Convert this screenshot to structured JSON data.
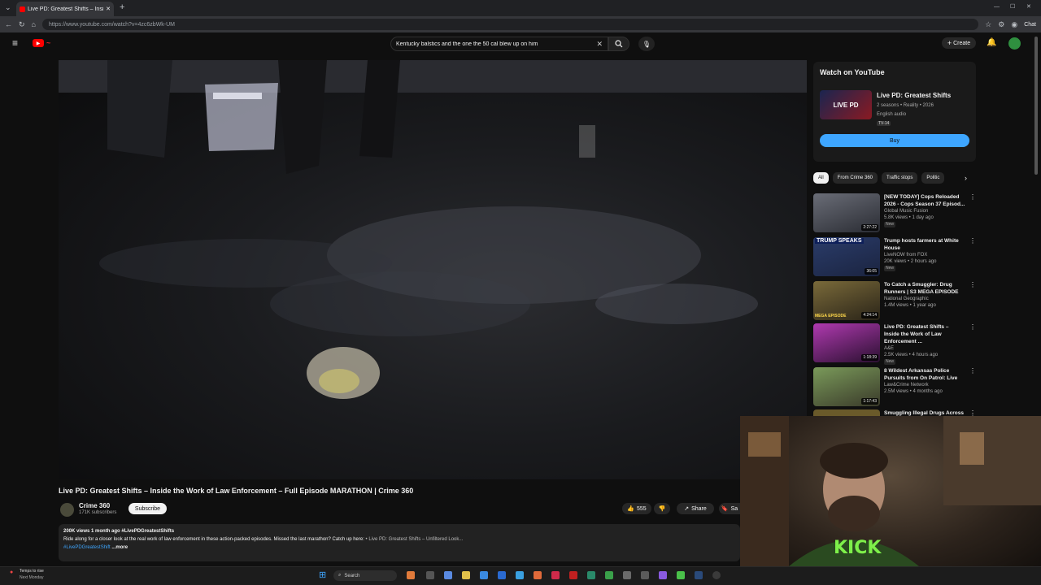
{
  "browser": {
    "tab_title": "Live PD: Greatest Shifts – Insi",
    "url": "https://www.youtube.com/watch?v=4zc6zbWk-UM",
    "chat_label": "Chat"
  },
  "header": {
    "search_value": "Kentucky balstics and the one the 50 cal blew up on him",
    "create_label": "Create"
  },
  "video": {
    "title": "Live PD: Greatest Shifts – Inside the Work of Law Enforcement – Full Episode MARATHON | Crime 360",
    "channel": "Crime 360",
    "subscribers": "171K subscribers",
    "subscribe_label": "Subscribe",
    "likes": "555",
    "share_label": "Share",
    "save_label": "Sa",
    "views_time": "200K views  1 month ago  #LivePDGreatestShifts",
    "description": "Ride along for a closer look at the real work of law enforcement in these action-packed episodes. Missed the last marathon? Catch up here:",
    "desc_link": "• Live PD: Greatest Shifts – Unfiltered Look...",
    "hashtag": "#LivePDGreatestShift",
    "more_label": "...more"
  },
  "watch_on": {
    "heading": "Watch on YouTube",
    "title": "Live PD: Greatest Shifts",
    "meta1": "2 seasons • Reality • 2026",
    "meta2": "English audio",
    "rating": "TV-14",
    "buy_label": "Buy",
    "thumb_text": "LIVE PD"
  },
  "chips": [
    "All",
    "From Crime 360",
    "Traffic stops",
    "Politic"
  ],
  "recommendations": [
    {
      "title": "[NEW TODAY] Cops Reloaded 2026 - Cops Season 37 Episod...",
      "channel": "Global Music Fusion",
      "stats": "5.8K views • 1 day ago",
      "badge": "New",
      "duration": "2:27:22",
      "color": "#3a3d44"
    },
    {
      "title": "Trump hosts farmers at White House",
      "channel": "LiveNOW from FOX",
      "stats": "20K views • 2 hours ago",
      "badge": "New",
      "duration": "36:05",
      "color": "#2c3a5c",
      "overlay": "TRUMP SPEAKS"
    },
    {
      "title": "To Catch a Smuggler: Drug Runners | S3 MEGA EPISODE",
      "channel": "National Geographic",
      "stats": "1.4M views • 1 year ago",
      "badge": "",
      "duration": "4:24:14",
      "color": "#5a4a2a",
      "overlay": "MEGA EPISODE"
    },
    {
      "title": "Live PD: Greatest Shifts – Inside the Work of Law Enforcement ...",
      "channel": "A&E",
      "stats": "2.5K views • 4 hours ago",
      "badge": "New",
      "duration": "1:18:39",
      "color": "#7a2a7a"
    },
    {
      "title": "8 Wildest Arkansas Police Pursuits from On Patrol: Live",
      "channel": "Law&Crime Network",
      "stats": "2.5M views • 4 months ago",
      "badge": "",
      "duration": "1:17:43",
      "color": "#4a6a3a"
    },
    {
      "title": "Smuggling Illegal Drugs Across",
      "channel": "",
      "stats": "",
      "badge": "",
      "duration": "",
      "color": "#6a5a2a"
    }
  ],
  "taskbar": {
    "weather_line1": "Temps to rise",
    "weather_line2": "Next Monday",
    "search_label": "Search"
  },
  "webcam": {
    "shirt_text": "KICK"
  }
}
